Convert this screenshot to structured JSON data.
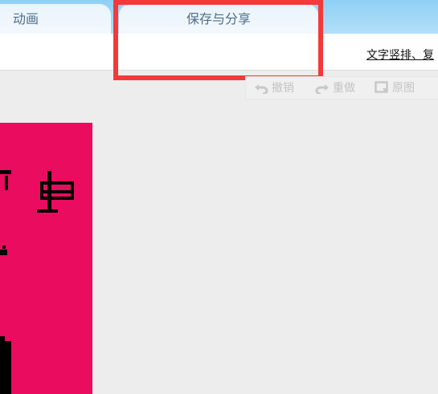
{
  "tabs": [
    {
      "label": "动画"
    },
    {
      "label": "保存与分享"
    }
  ],
  "toolbar": {
    "vertical_text_label": "文字竖排、复"
  },
  "edit_bar": {
    "undo_label": "撤销",
    "redo_label": "重做",
    "original_label": "原图"
  },
  "colors": {
    "highlight": "#f23a3a",
    "poster_background": "#e90c5f",
    "tab_strip": "#9fd6f6"
  }
}
